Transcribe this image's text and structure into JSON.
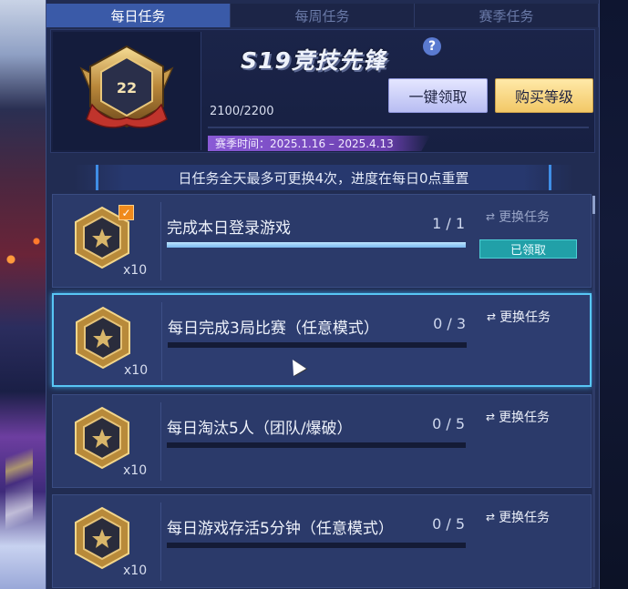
{
  "tabs": [
    {
      "label": "每日任务",
      "active": true
    },
    {
      "label": "每周任务",
      "active": false
    },
    {
      "label": "赛季任务",
      "active": false
    }
  ],
  "header": {
    "level_badge": "22",
    "season_title": "S19竞技先锋",
    "help_icon": "question-mark-icon",
    "exp_progress": "2100/2200",
    "season_time": "赛季时间：2025.1.16 – 2025.4.13",
    "claim_all_label": "一键领取",
    "buy_level_label": "购买等级"
  },
  "info_text": "日任务全天最多可更换4次，进度在每日0点重置",
  "tasks": [
    {
      "title": "完成本日登录游戏",
      "progress": "1 / 1",
      "fill": 1.0,
      "reward": "x10",
      "swap_label": "更换任务",
      "claimed_label": "已领取",
      "completed": true
    },
    {
      "title": "每日完成3局比赛（任意模式）",
      "progress": "0 / 3",
      "fill": 0.0,
      "reward": "x10",
      "swap_label": "更换任务",
      "selected": true
    },
    {
      "title": "每日淘汰5人（团队/爆破）",
      "progress": "0 / 5",
      "fill": 0.0,
      "reward": "x10",
      "swap_label": "更换任务"
    },
    {
      "title": "每日游戏存活5分钟（任意模式）",
      "progress": "0 / 5",
      "fill": 0.0,
      "reward": "x10",
      "swap_label": "更换任务"
    }
  ],
  "colors": {
    "active_tab": "#3a5aa8",
    "selected_border": "#58c6f4",
    "claim_all_button": "#c8ccf6",
    "buy_level_button": "#f6d37a",
    "claimed_tag": "#21a0a8",
    "season_time_bg": "#7a4cc6"
  }
}
